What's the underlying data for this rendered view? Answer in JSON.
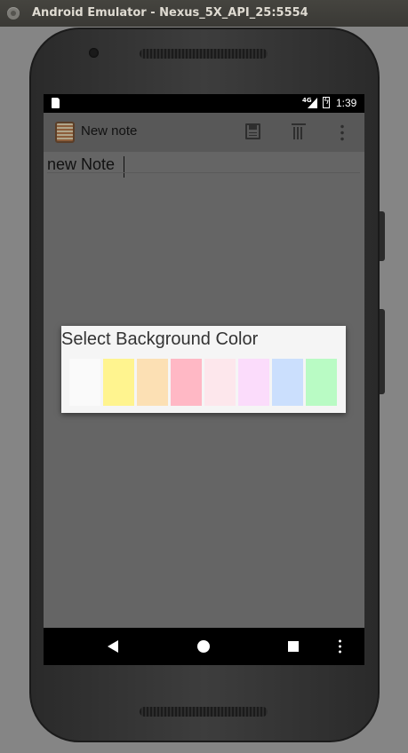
{
  "window": {
    "title": "Android Emulator - Nexus_5X_API_25:5554"
  },
  "status_bar": {
    "network": "4G",
    "time": "1:39"
  },
  "app_bar": {
    "title": "New note"
  },
  "note": {
    "text": "new Note"
  },
  "dialog": {
    "title": "Select Background Color",
    "colors": [
      "#fafafa",
      "#fff48f",
      "#fce0b4",
      "#ffb8c5",
      "#fde7ec",
      "#fbdcfb",
      "#cbdffd",
      "#b9fbc4"
    ]
  }
}
